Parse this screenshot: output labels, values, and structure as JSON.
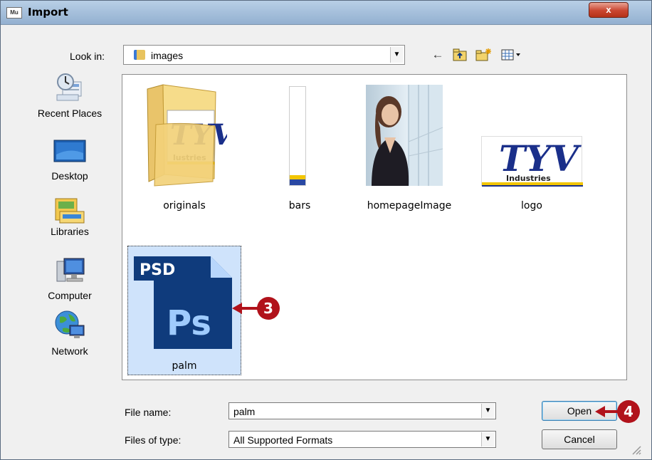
{
  "window": {
    "title": "Import",
    "icon_text": "Mu",
    "close_label": "x"
  },
  "lookin": {
    "label": "Look in:",
    "label_hotkey": "i",
    "value": "images"
  },
  "toolbar": {
    "back": "←",
    "up": "⤴",
    "new_folder": "✱",
    "views": "▦▾"
  },
  "places": [
    {
      "label": "Recent Places",
      "icon": "recent-places-icon"
    },
    {
      "label": "Desktop",
      "icon": "desktop-icon"
    },
    {
      "label": "Libraries",
      "icon": "libraries-icon"
    },
    {
      "label": "Computer",
      "icon": "computer-icon"
    },
    {
      "label": "Network",
      "icon": "network-icon"
    }
  ],
  "files": [
    {
      "name": "originals",
      "type": "folder"
    },
    {
      "name": "bars",
      "type": "image"
    },
    {
      "name": "homepageImage",
      "type": "image"
    },
    {
      "name": "logo",
      "type": "image"
    },
    {
      "name": "palm",
      "type": "psd",
      "selected": true
    }
  ],
  "logo_text": {
    "brand": "TYV",
    "sub": "Industries",
    "partial": "lustries"
  },
  "psd_icon": {
    "badge": "PSD",
    "mark": "Ps"
  },
  "bottom": {
    "file_name_label": "File name:",
    "file_name_hotkey": "n",
    "file_name_value": "palm",
    "file_type_label": "Files of type:",
    "file_type_hotkey": "t",
    "file_type_value": "All Supported Formats",
    "open_label": "Open",
    "open_hotkey": "O",
    "cancel_label": "Cancel"
  },
  "callouts": [
    "3",
    "4"
  ],
  "colors": {
    "callout": "#b1121b",
    "selection": "#cfe3fb",
    "psd_blue": "#0d3a7a",
    "logo_yellow": "#f2c500"
  }
}
